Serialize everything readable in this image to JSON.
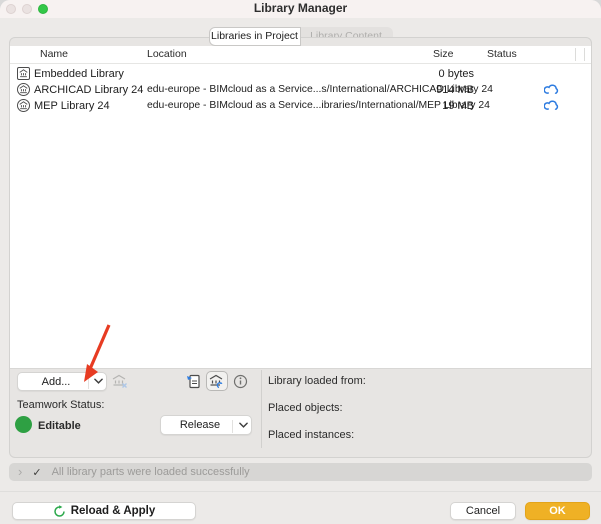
{
  "window": {
    "title": "Library Manager"
  },
  "tabs": {
    "libraries_in_project": "Libraries in Project",
    "library_content": "Library Content"
  },
  "table": {
    "columns": [
      "Name",
      "Location",
      "Size",
      "Status"
    ],
    "rows": [
      {
        "name": "Embedded Library",
        "location": "",
        "size": "0 bytes",
        "status_icon": ""
      },
      {
        "name": "ARCHICAD Library 24",
        "location": "edu-europe - BIMcloud as a Service...s/International/ARCHICAD Library 24",
        "size": "914 MB",
        "status_icon": "cloud-sync"
      },
      {
        "name": "MEP Library 24",
        "location": "edu-europe - BIMcloud as a Service...ibraries/International/MEP Library 24",
        "size": "19 MB",
        "status_icon": "cloud-sync"
      }
    ]
  },
  "controls": {
    "add_button": "Add...",
    "teamwork_status_label": "Teamwork Status:",
    "teamwork_status_value": "Editable",
    "release_button": "Release",
    "library_loaded_from_label": "Library loaded from:",
    "placed_objects_label": "Placed objects:",
    "placed_instances_label": "Placed instances:"
  },
  "status_bar": {
    "checkmark": "✓",
    "message": "All library parts were loaded successfully"
  },
  "footer": {
    "reload_apply_button": "Reload & Apply",
    "cancel_button": "Cancel",
    "ok_button": "OK"
  },
  "colors": {
    "ok_accent": "#EFB125",
    "editable_green": "#2EA043",
    "cloud_blue": "#2E7CE0",
    "annotation_red": "#E73B22"
  }
}
